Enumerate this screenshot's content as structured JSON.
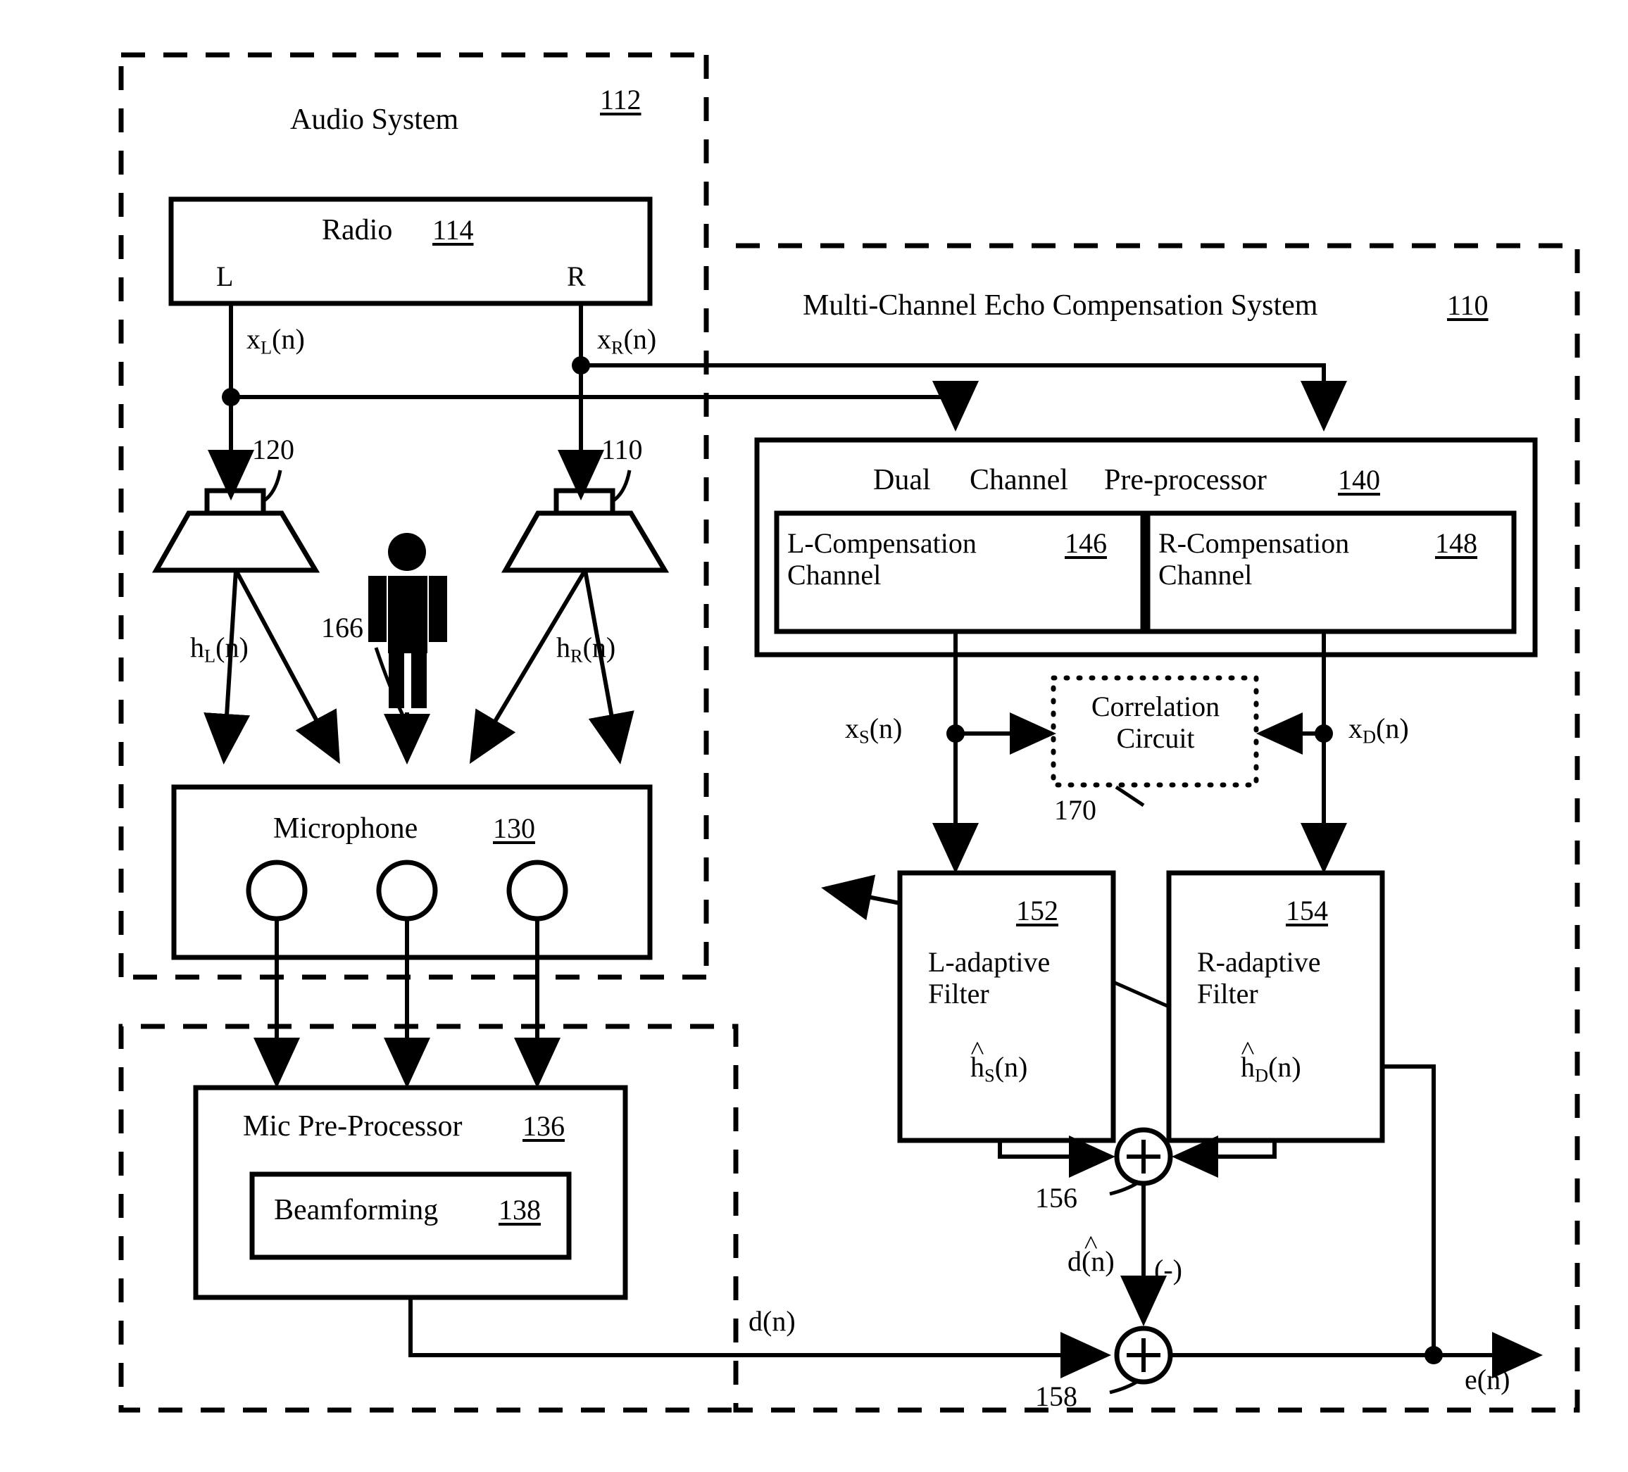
{
  "figure": {
    "type": "patent-block-diagram",
    "title": "Multi-Channel Echo Compensation System block diagram"
  },
  "audio_system": {
    "title": "Audio System",
    "ref": "112",
    "radio": {
      "label": "Radio",
      "ref": "114",
      "out_left": "L",
      "out_right": "R"
    },
    "signals": {
      "x_left": "x",
      "x_left_sub": "L",
      "x_left_tail": "(n)",
      "x_right": "x",
      "x_right_sub": "R",
      "x_right_tail": "(n)"
    },
    "speaker_left_ref": "120",
    "speaker_right_ref": "110",
    "impulse_left": "h",
    "impulse_left_sub": "L",
    "impulse_left_tail": "(n)",
    "impulse_right": "h",
    "impulse_right_sub": "R",
    "impulse_right_tail": "(n)",
    "person_ref": "166",
    "microphone": {
      "label": "Microphone",
      "ref": "130"
    }
  },
  "mic_preprocessor": {
    "label": "Mic Pre-Processor",
    "ref": "136",
    "beamforming": {
      "label": "Beamforming",
      "ref": "138"
    },
    "output_signal": "d(n)"
  },
  "echo_system": {
    "title": "Multi-Channel Echo Compensation System",
    "ref": "110",
    "preprocessor": {
      "label_part1": "Dual",
      "label_part2": "Channel",
      "label_part3": "Pre-processor",
      "ref": "140",
      "channels": [
        {
          "line1": "L-Compensation",
          "line2": "Channel",
          "ref": "146"
        },
        {
          "line1": "R-Compensation",
          "line2": "Channel",
          "ref": "148"
        }
      ]
    },
    "signals": {
      "x_s": "x",
      "x_s_sub": "S",
      "x_s_tail": "(n)",
      "x_d": "x",
      "x_d_sub": "D",
      "x_d_tail": "(n)"
    },
    "correlation_circuit": {
      "line1": "Correlation",
      "line2": "Circuit",
      "ref": "170"
    },
    "filters": [
      {
        "ref": "152",
        "line1": "L-adaptive",
        "line2": "Filter",
        "coef": "h",
        "coef_sub": "S",
        "coef_tail": "(n)",
        "hat": "˄"
      },
      {
        "ref": "154",
        "line1": "R-adaptive",
        "line2": "Filter",
        "coef": "h",
        "coef_sub": "D",
        "coef_tail": "(n)",
        "hat": "˄"
      }
    ],
    "summer_1": {
      "symbol": "+",
      "ref": "156"
    },
    "summer_2": {
      "symbol": "+",
      "ref": "158"
    },
    "estimate_signal": {
      "base": "d(n)",
      "hat": "˄"
    },
    "negative_sign": "(-)",
    "error_signal": "e(n)"
  },
  "colors": {
    "ink": "#000000",
    "paper": "#ffffff"
  }
}
